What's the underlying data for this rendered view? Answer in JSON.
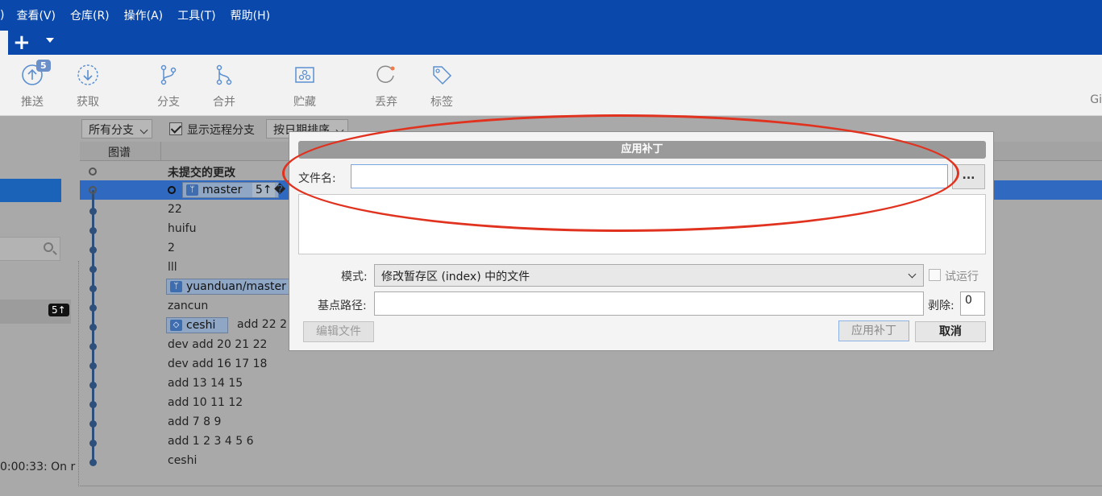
{
  "menu": {
    "fragment": ")",
    "items": [
      "查看(V)",
      "仓库(R)",
      "操作(A)",
      "工具(T)",
      "帮助(H)"
    ]
  },
  "toolbar": {
    "push_label": "推送",
    "push_badge": "5",
    "fetch_label": "获取",
    "branch_label": "分支",
    "merge_label": "合并",
    "stash_label": "贮藏",
    "discard_label": "丢弃",
    "tag_label": "标签",
    "gitflow_label": "Gi"
  },
  "filters": {
    "branches": "所有分支",
    "show_remote_label": "显示远程分支",
    "sort": "按日期排序"
  },
  "columns": {
    "graph": "图谱"
  },
  "left_panel": {
    "badge": "5↑",
    "timestamp": "0:00:33: On r"
  },
  "commits": {
    "uncommitted": "未提交的更改",
    "head_branch": "master",
    "head_count": "5↑",
    "head_glyph": "�",
    "rows": [
      "22",
      "huifu",
      "2",
      "lll",
      "",
      "zancun",
      "",
      "dev add 20 21 22",
      "dev add 16 17 18",
      "add 13 14 15",
      "add 10 11 12",
      "add 7 8 9",
      "add 1 2 3 4 5 6",
      "ceshi"
    ],
    "remote_branch": "yuanduan/master",
    "tag_name": "ceshi",
    "tag_msg": "add 22 2"
  },
  "dialog": {
    "title": "应用补丁",
    "filename_label": "文件名:",
    "filename_value": "",
    "browse_label": "...",
    "mode_label": "模式:",
    "mode_value": "修改暂存区 (index) 中的文件",
    "dry_run_label": "试运行",
    "base_path_label": "基点路径:",
    "base_path_value": "",
    "strip_label": "剥除:",
    "strip_value": "0",
    "edit_file_label": "编辑文件",
    "apply_label": "应用补丁",
    "cancel_label": "取消"
  },
  "colors": {
    "menubar": "#0a48ab",
    "selection": "#2f6ac0",
    "annotation": "#e0321e"
  }
}
